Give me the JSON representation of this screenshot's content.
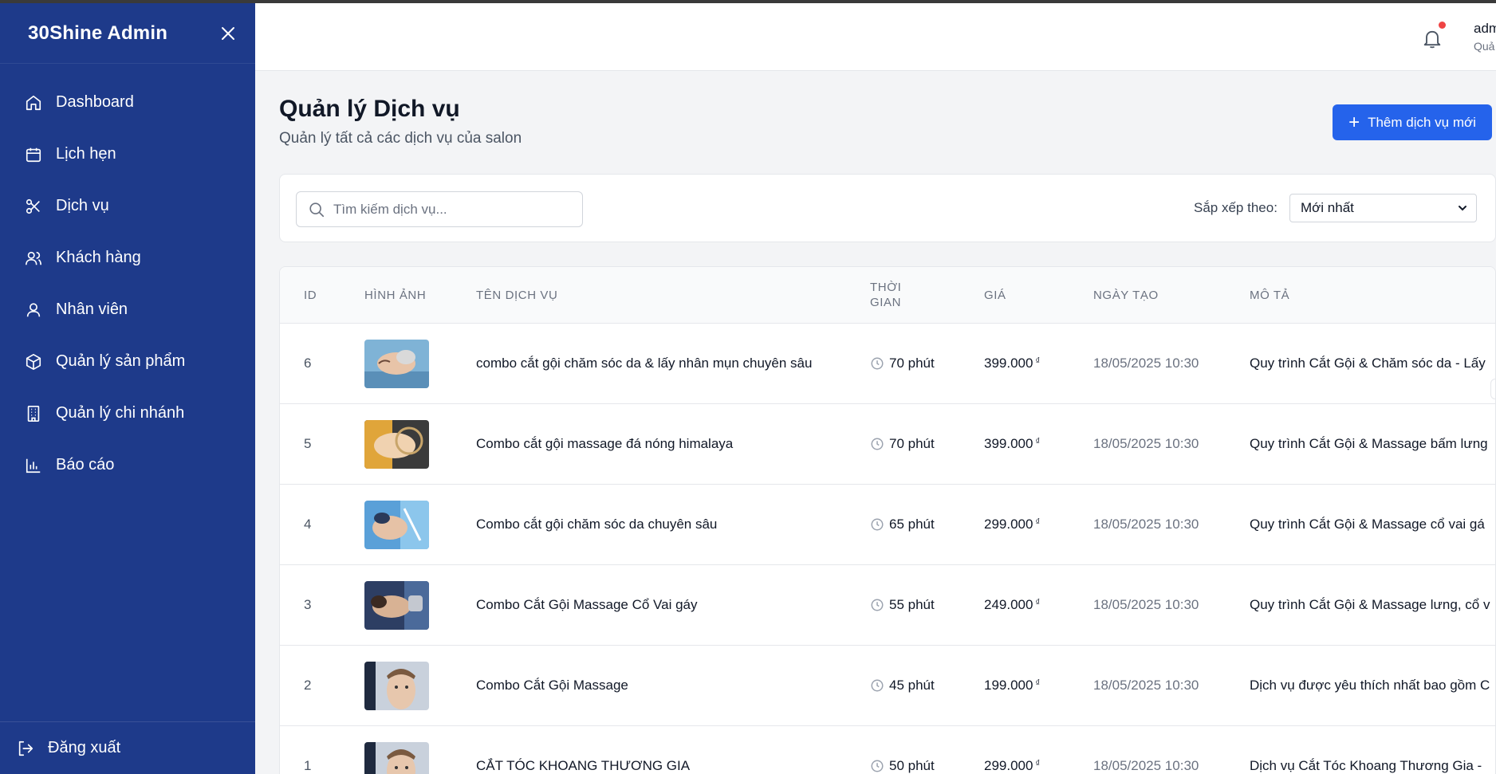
{
  "sidebar": {
    "brand": "30Shine Admin",
    "items": [
      {
        "label": "Dashboard",
        "icon": "home-icon"
      },
      {
        "label": "Lịch hẹn",
        "icon": "calendar-icon"
      },
      {
        "label": "Dịch vụ",
        "icon": "scissors-icon"
      },
      {
        "label": "Khách hàng",
        "icon": "users-icon"
      },
      {
        "label": "Nhân viên",
        "icon": "user-icon"
      },
      {
        "label": "Quản lý sản phẩm",
        "icon": "box-icon"
      },
      {
        "label": "Quản lý chi nhánh",
        "icon": "building-icon"
      },
      {
        "label": "Báo cáo",
        "icon": "bar-chart-icon"
      }
    ],
    "logout": "Đăng xuất"
  },
  "header": {
    "user_name": "adm",
    "user_role": "Quả"
  },
  "main": {
    "title": "Quản lý Dịch vụ",
    "subtitle": "Quản lý tất cả các dịch vụ của salon",
    "add_button": "Thêm dịch vụ mới",
    "search_placeholder": "Tìm kiếm dịch vụ...",
    "sort_label": "Sắp xếp theo:",
    "sort_value": "Mới nhất"
  },
  "table": {
    "headers": {
      "id": "ID",
      "image": "HÌNH ẢNH",
      "name": "TÊN DỊCH VỤ",
      "time_1": "THỜI",
      "time_2": "GIAN",
      "price": "GIÁ",
      "date": "NGÀY TẠO",
      "desc": "MÔ TẢ"
    },
    "rows": [
      {
        "id": "6",
        "name": "combo cắt gội chăm sóc da & lấy nhân mụn chuyên sâu",
        "time": "70 phút",
        "price": "399.000",
        "currency": "₫",
        "date": "18/05/2025 10:30",
        "desc": "Quy trình Cắt Gội & Chăm sóc da - Lấy"
      },
      {
        "id": "5",
        "name": "Combo cắt gội massage đá nóng himalaya",
        "time": "70 phút",
        "price": "399.000",
        "currency": "₫",
        "date": "18/05/2025 10:30",
        "desc": "Quy trình Cắt Gội & Massage bấm lưng"
      },
      {
        "id": "4",
        "name": "Combo cắt gội chăm sóc da chuyên sâu",
        "time": "65 phút",
        "price": "299.000",
        "currency": "₫",
        "date": "18/05/2025 10:30",
        "desc": "Quy trình Cắt Gội & Massage cổ vai gá"
      },
      {
        "id": "3",
        "name": "Combo Cắt Gội Massage Cổ Vai gáy",
        "time": "55 phút",
        "price": "249.000",
        "currency": "₫",
        "date": "18/05/2025 10:30",
        "desc": "Quy trình Cắt Gội & Massage lưng, cổ v"
      },
      {
        "id": "2",
        "name": "Combo Cắt Gội Massage",
        "time": "45 phút",
        "price": "199.000",
        "currency": "₫",
        "date": "18/05/2025 10:30",
        "desc": "Dịch vụ được yêu thích nhất bao gồm C"
      },
      {
        "id": "1",
        "name": "CẮT TÓC KHOANG THƯƠNG GIA",
        "time": "50 phút",
        "price": "299.000",
        "currency": "₫",
        "date": "18/05/2025 10:30",
        "desc": "Dịch vụ Cắt Tóc Khoang Thương Gia -"
      }
    ]
  },
  "colors": {
    "sidebar_bg": "#1e3a8a",
    "accent": "#2563eb",
    "notification_dot": "#ef4444"
  }
}
